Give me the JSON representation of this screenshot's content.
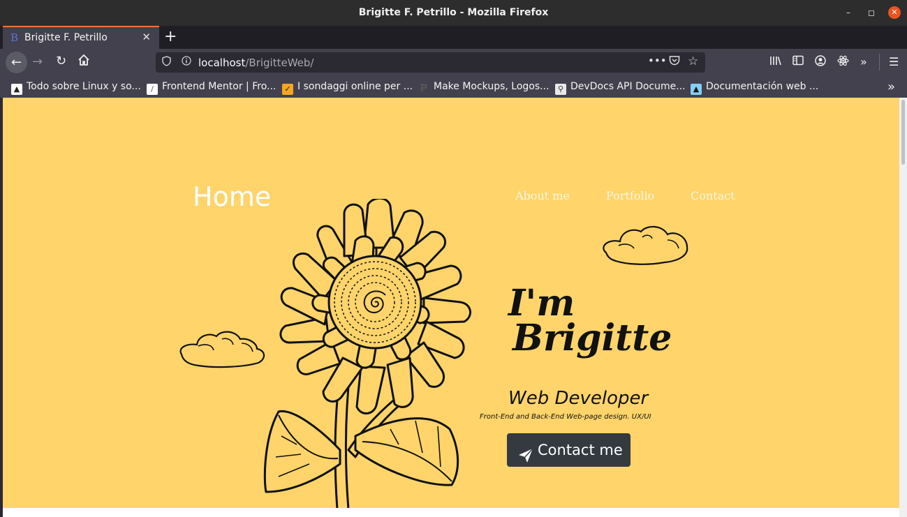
{
  "window": {
    "title": "Brigitte F. Petrillo - Mozilla Firefox"
  },
  "tab": {
    "title": "Brigitte F. Petrillo",
    "favicon_letter": "B"
  },
  "urlbar": {
    "host": "localhost",
    "path": "/BrigitteWeb/"
  },
  "bookmarks": [
    {
      "label": "Todo sobre Linux y so...",
      "icon": "linux-site-icon",
      "color": "#ffffff"
    },
    {
      "label": "Frontend Mentor | Fro...",
      "icon": "frontend-mentor-icon",
      "color": "#ffffff"
    },
    {
      "label": "I sondaggi online per ...",
      "icon": "survey-site-icon",
      "color": "#f5a623"
    },
    {
      "label": "Make Mockups, Logos...",
      "icon": "placeit-icon",
      "color": "#555555"
    },
    {
      "label": "DevDocs API Docume...",
      "icon": "devdocs-icon",
      "color": "#e8e8e8"
    },
    {
      "label": "Documentación web ...",
      "icon": "mdn-icon",
      "color": "#83d0f2"
    }
  ],
  "site": {
    "logo": "Home",
    "nav": {
      "about": "About me",
      "portfolio": "Portfolio",
      "contact": "Contact"
    },
    "hero": {
      "greeting_line1": "I'm",
      "greeting_line2": "Brigitte",
      "role": "Web Developer",
      "description": "Front-End and Back-End Web-page design. UX/UI",
      "cta_label": "Contact me"
    },
    "colors": {
      "background": "#fed46b",
      "button": "#343a40",
      "accent": "#ff7139"
    }
  }
}
